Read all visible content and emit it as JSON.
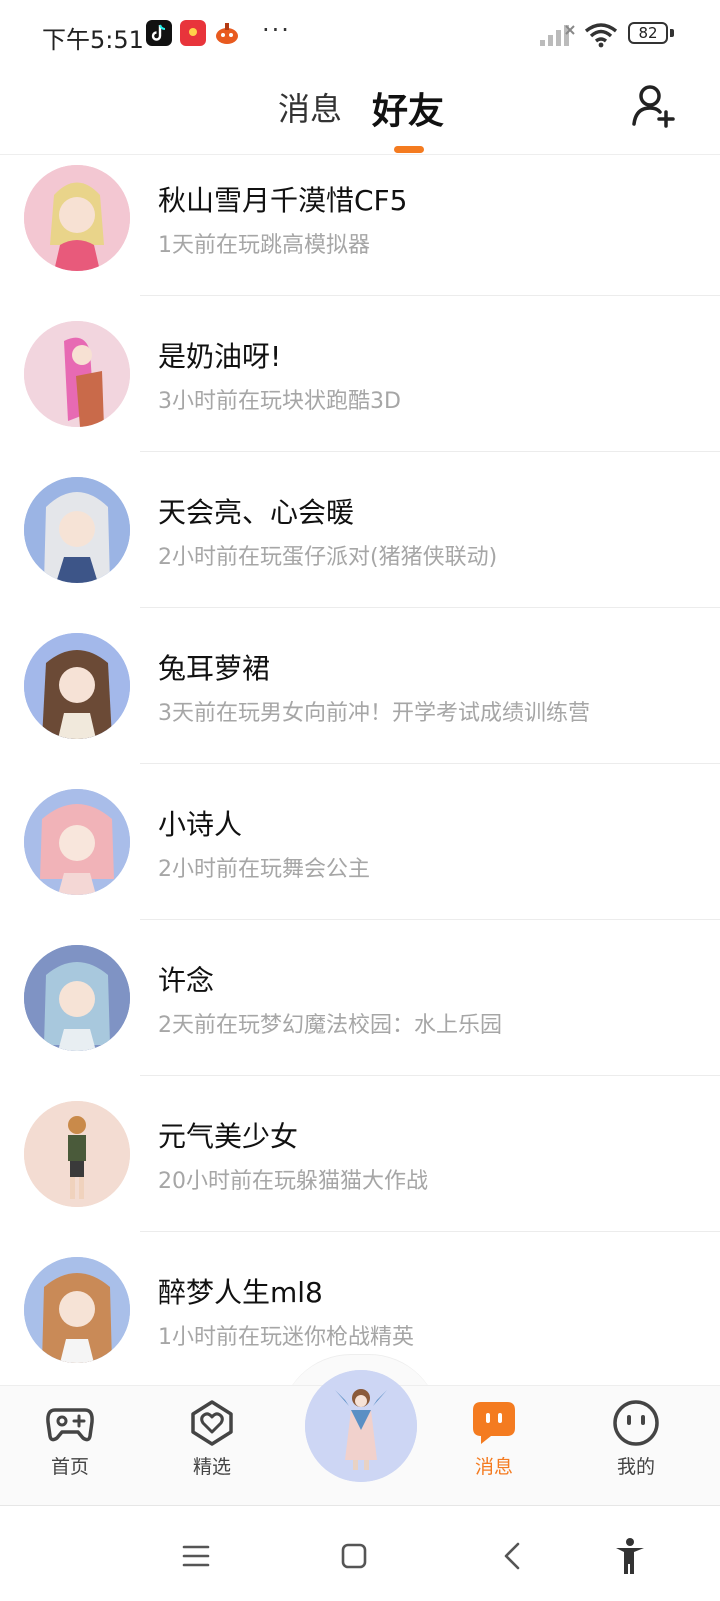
{
  "status_bar": {
    "time": "下午5:51",
    "battery": "82",
    "dots": "···"
  },
  "header": {
    "tabs": [
      {
        "label": "消息",
        "active": false
      },
      {
        "label": "好友",
        "active": true
      }
    ],
    "accent_color": "#f47b20"
  },
  "friends": [
    {
      "name": "秋山雪月千漠惜CF5",
      "status": "1天前在玩跳高模拟器",
      "avatar_bg": "#f3c7d2"
    },
    {
      "name": "是奶油呀!",
      "status": "3小时前在玩块状跑酷3D",
      "avatar_bg": "#f2d5de"
    },
    {
      "name": "天会亮、心会暖",
      "status": "2小时前在玩蛋仔派对(猪猪侠联动)",
      "avatar_bg": "#9bb4e4"
    },
    {
      "name": "兔耳萝裙",
      "status": "3天前在玩男女向前冲！开学考试成绩训练营",
      "avatar_bg": "#a3b8ea"
    },
    {
      "name": "小诗人",
      "status": "2小时前在玩舞会公主",
      "avatar_bg": "#a9bde9"
    },
    {
      "name": "许念",
      "status": "2天前在玩梦幻魔法校园：水上乐园",
      "avatar_bg": "#7f93c4"
    },
    {
      "name": "元气美少女",
      "status": "20小时前在玩躲猫猫大作战",
      "avatar_bg": "#f3dcd2"
    },
    {
      "name": "醉梦人生ml8",
      "status": "1小时前在玩迷你枪战精英",
      "avatar_bg": "#a9bfe9"
    }
  ],
  "bottom_nav": {
    "items": [
      {
        "label": "首页",
        "icon": "gamepad-icon"
      },
      {
        "label": "精选",
        "icon": "heart-badge-icon"
      },
      {
        "label": "消息",
        "icon": "message-icon",
        "active": true
      },
      {
        "label": "我的",
        "icon": "face-icon"
      }
    ]
  },
  "system_nav": {
    "icons": [
      "menu-icon",
      "home-square-icon",
      "back-chevron-icon",
      "accessibility-icon"
    ]
  }
}
